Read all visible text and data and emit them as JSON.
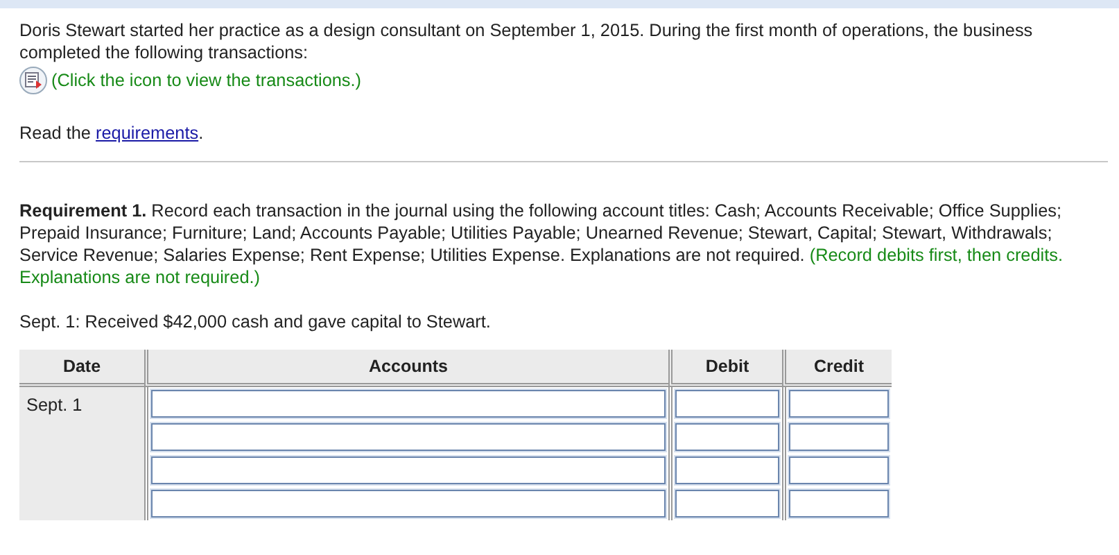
{
  "intro": {
    "text": "Doris Stewart started her practice as a design consultant on September 1, 2015. During the first month of operations, the business completed the following transactions:",
    "icon_hint": "(Click the icon to view the transactions.)",
    "read_prefix": "Read the",
    "read_link": "requirements",
    "read_suffix": "."
  },
  "requirement": {
    "text": "**Requirement 1.** Record each transaction in the journal using the following account titles: Cash; Accounts Receivable; Office Supplies; Prepaid Insurance; Furniture; Land; Accounts Payable; Utilities Payable; Unearned Revenue; Stewart, Capital; Stewart, Withdrawals; Service Revenue; Salaries Expense; Rent Expense; Utilities Expense. Explanations are not required.",
    "instruction": "(Record debits first, then credits. Explanations are not required.)"
  },
  "transaction": "Sept. 1: Received $42,000 cash and gave capital to Stewart.",
  "journal": {
    "columns": [
      "Date",
      "Accounts",
      "Debit",
      "Credit"
    ],
    "date": "Sept. 1",
    "row_count_rows": [
      {
        "account": "",
        "debit": "",
        "credit": ""
      },
      {
        "account": "",
        "debit": "",
        "credit": ""
      },
      {
        "account": "",
        "debit": "",
        "credit": ""
      },
      {
        "account": "",
        "debit": "",
        "credit": ""
      }
    ]
  }
}
